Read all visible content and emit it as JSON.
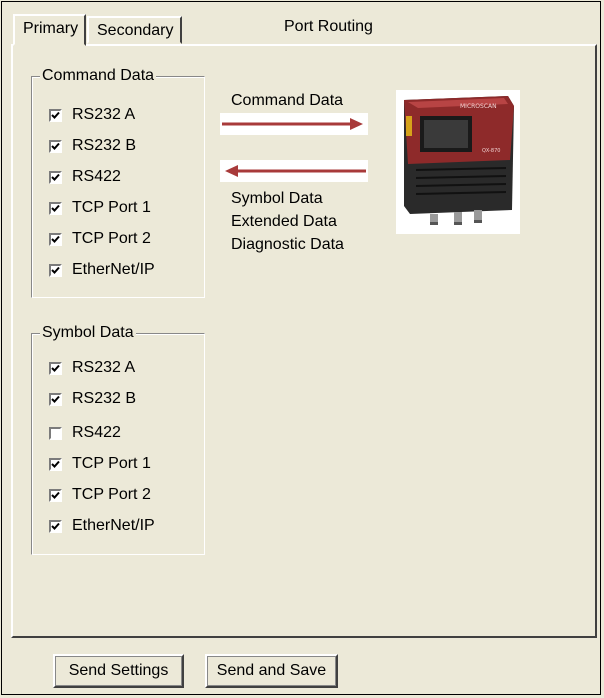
{
  "tabs": [
    {
      "label": "Primary",
      "active": true
    },
    {
      "label": "Secondary",
      "active": false
    }
  ],
  "panel_title": "Port Routing",
  "command_group": {
    "legend": "Command Data",
    "items": [
      {
        "label": "RS232 A",
        "checked": true
      },
      {
        "label": "RS232 B",
        "checked": true
      },
      {
        "label": "RS422",
        "checked": true
      },
      {
        "label": "TCP Port 1",
        "checked": true
      },
      {
        "label": "TCP Port 2",
        "checked": true
      },
      {
        "label": "EtherNet/IP",
        "checked": true
      }
    ]
  },
  "symbol_group": {
    "legend": "Symbol Data",
    "items": [
      {
        "label": "RS232 A",
        "checked": true
      },
      {
        "label": "RS232 B",
        "checked": true
      },
      {
        "label": "RS422",
        "checked": false
      },
      {
        "label": "TCP Port 1",
        "checked": true
      },
      {
        "label": "TCP Port 2",
        "checked": true
      },
      {
        "label": "EtherNet/IP",
        "checked": true
      }
    ]
  },
  "diagram": {
    "command_label": "Command Data",
    "output_labels": [
      "Symbol Data",
      "Extended Data",
      "Diagnostic Data"
    ],
    "arrow_color": "#a83a3a",
    "device_brand": "MICROSCAN",
    "device_model": "QX-870"
  },
  "buttons": {
    "send_settings": "Send Settings",
    "send_and_save": "Send and Save"
  }
}
